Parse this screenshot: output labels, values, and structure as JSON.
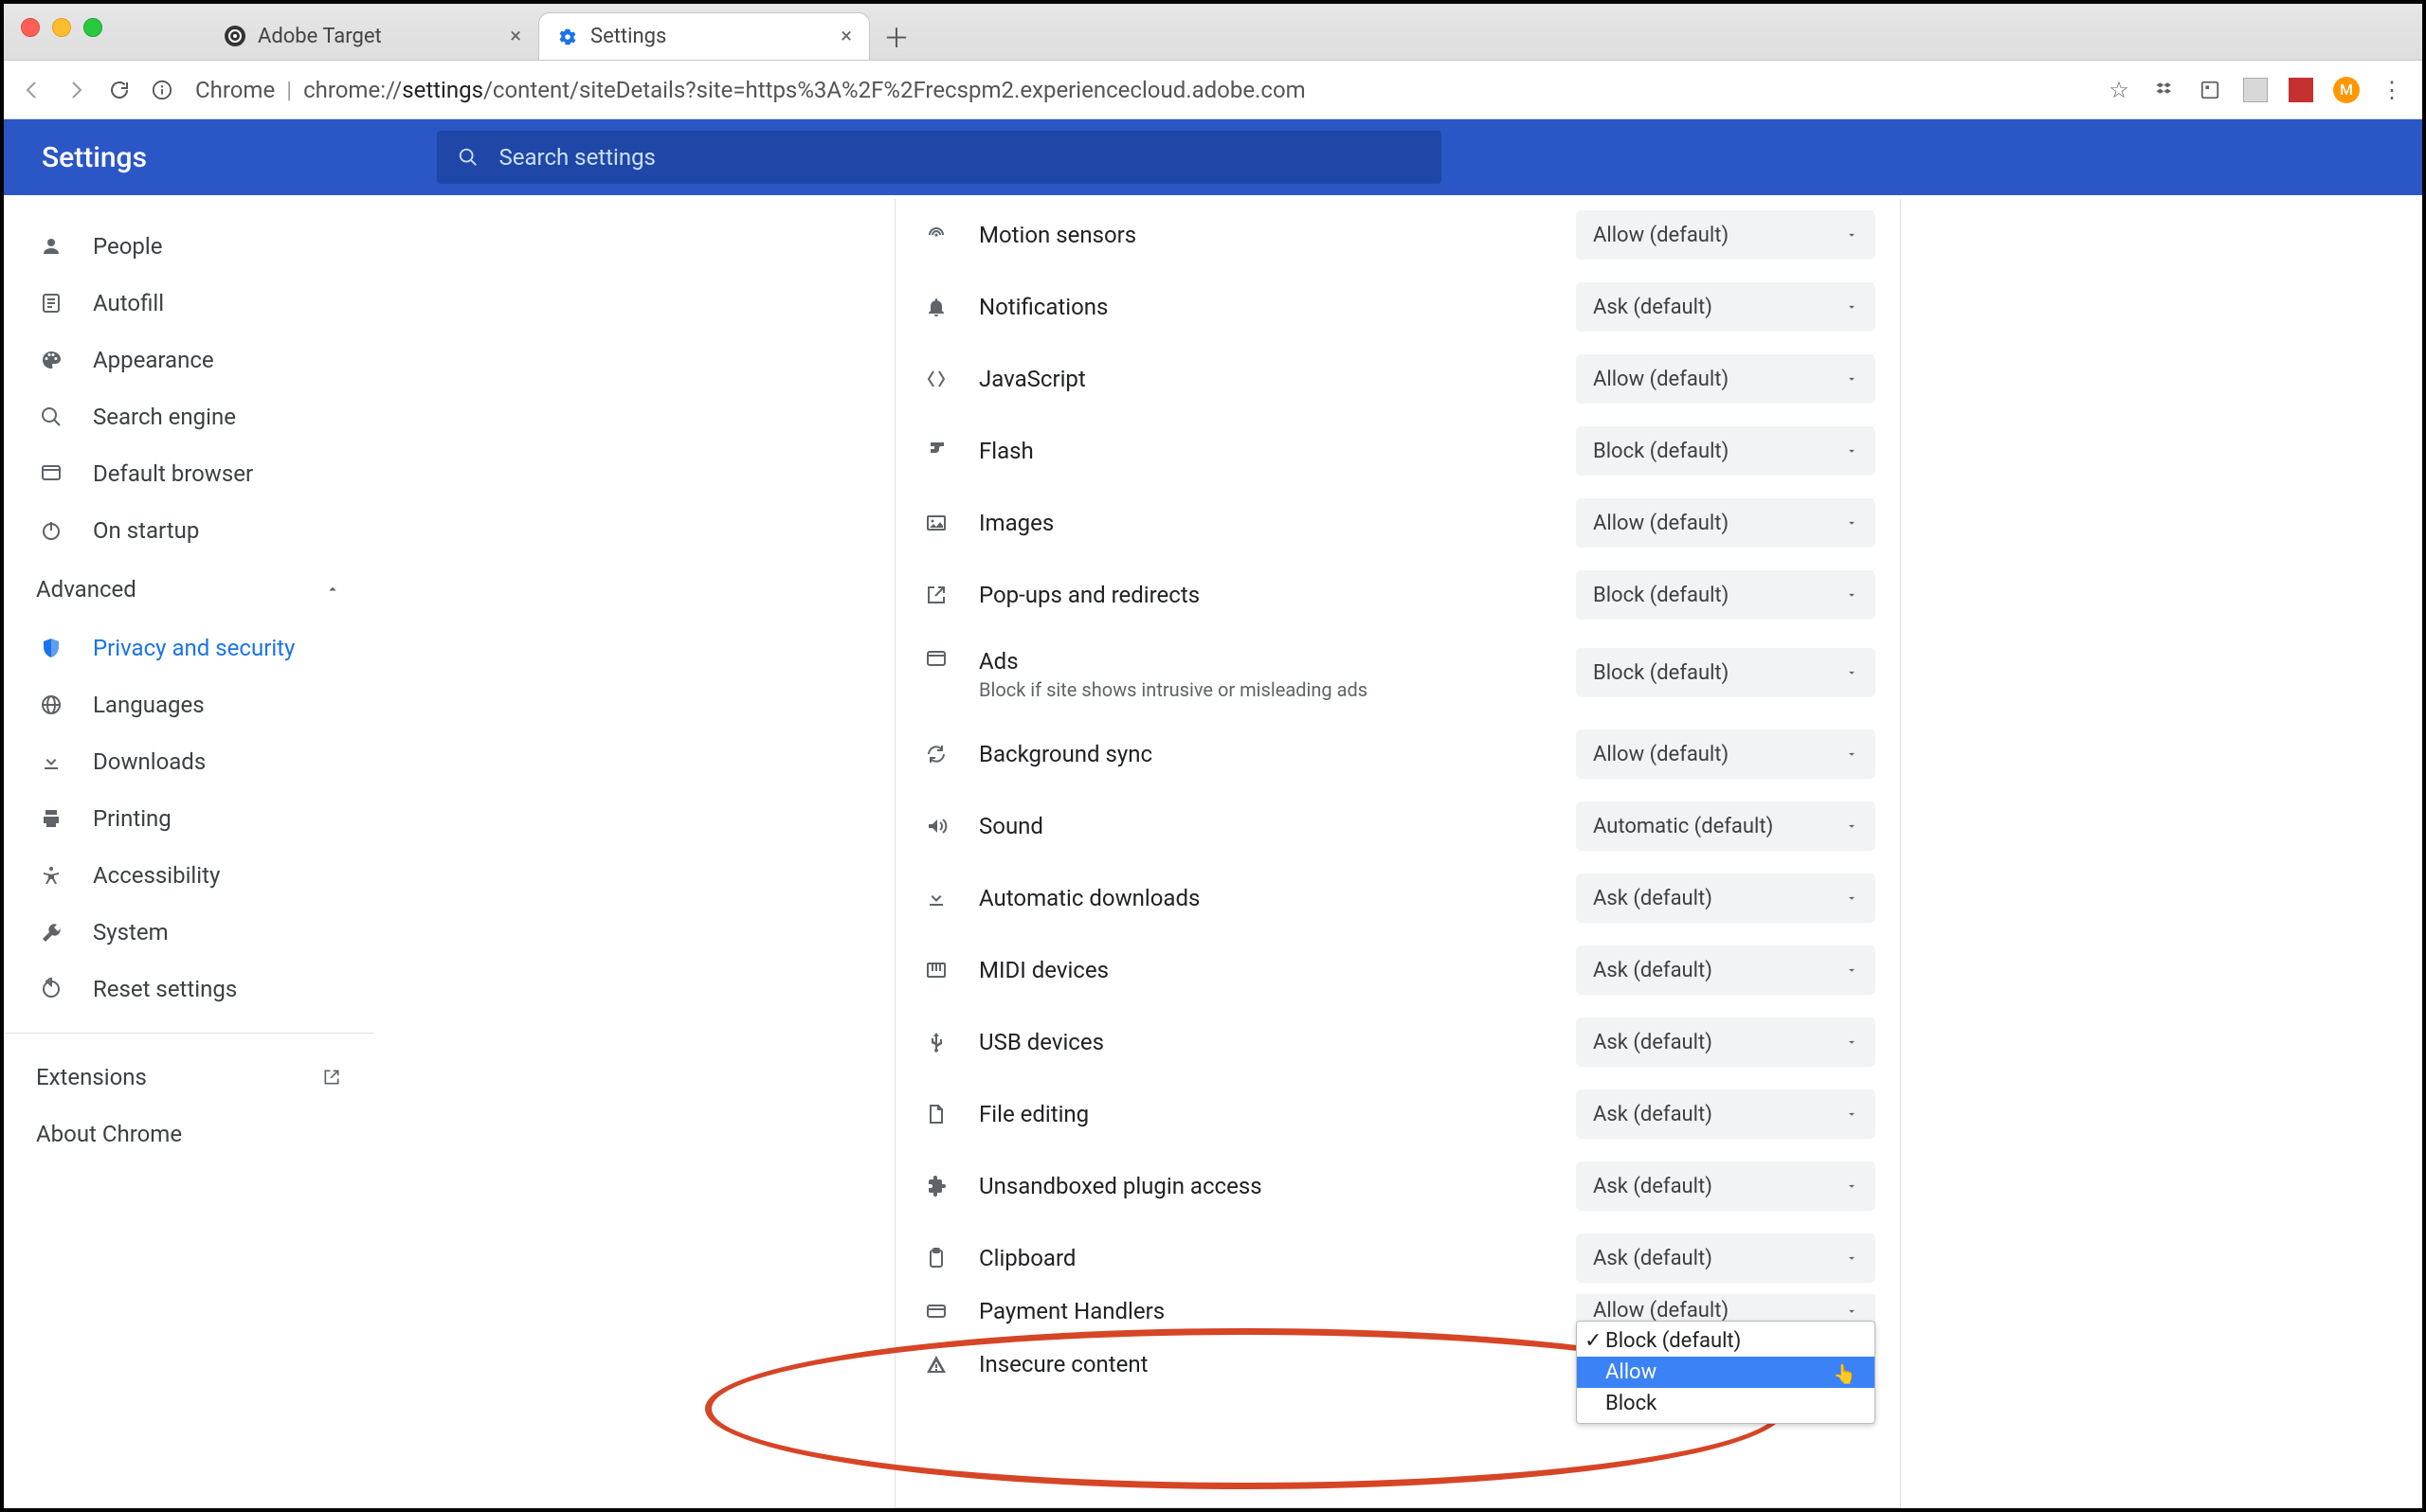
{
  "window": {
    "tabs": [
      {
        "title": "Adobe Target",
        "active": false
      },
      {
        "title": "Settings",
        "active": true
      }
    ],
    "url_prefix": "Chrome",
    "url_scheme": "chrome://",
    "url_bold": "settings",
    "url_rest": "/content/siteDetails?site=https%3A%2F%2Frecspm2.experiencecloud.adobe.com"
  },
  "header": {
    "title": "Settings",
    "search_placeholder": "Search settings"
  },
  "sidebar": {
    "items": [
      {
        "label": "People"
      },
      {
        "label": "Autofill"
      },
      {
        "label": "Appearance"
      },
      {
        "label": "Search engine"
      },
      {
        "label": "Default browser"
      },
      {
        "label": "On startup"
      }
    ],
    "advanced_label": "Advanced",
    "advanced_items": [
      {
        "label": "Privacy and security",
        "selected": true
      },
      {
        "label": "Languages"
      },
      {
        "label": "Downloads"
      },
      {
        "label": "Printing"
      },
      {
        "label": "Accessibility"
      },
      {
        "label": "System"
      },
      {
        "label": "Reset settings"
      }
    ],
    "footer": [
      {
        "label": "Extensions",
        "external": true
      },
      {
        "label": "About Chrome"
      }
    ]
  },
  "permissions": [
    {
      "label": "Motion sensors",
      "value": "Allow (default)"
    },
    {
      "label": "Notifications",
      "value": "Ask (default)"
    },
    {
      "label": "JavaScript",
      "value": "Allow (default)"
    },
    {
      "label": "Flash",
      "value": "Block (default)"
    },
    {
      "label": "Images",
      "value": "Allow (default)"
    },
    {
      "label": "Pop-ups and redirects",
      "value": "Block (default)"
    },
    {
      "label": "Ads",
      "sub": "Block if site shows intrusive or misleading ads",
      "value": "Block (default)"
    },
    {
      "label": "Background sync",
      "value": "Allow (default)"
    },
    {
      "label": "Sound",
      "value": "Automatic (default)"
    },
    {
      "label": "Automatic downloads",
      "value": "Ask (default)"
    },
    {
      "label": "MIDI devices",
      "value": "Ask (default)"
    },
    {
      "label": "USB devices",
      "value": "Ask (default)"
    },
    {
      "label": "File editing",
      "value": "Ask (default)"
    },
    {
      "label": "Unsandboxed plugin access",
      "value": "Ask (default)"
    },
    {
      "label": "Clipboard",
      "value": "Ask (default)"
    },
    {
      "label": "Payment Handlers",
      "value": "Allow (default)"
    },
    {
      "label": "Insecure content",
      "value": "Block (default)",
      "dropdown_open": true
    }
  ],
  "dropdown": {
    "options": [
      "Block (default)",
      "Allow",
      "Block"
    ],
    "checked": "Block (default)",
    "highlighted": "Allow"
  }
}
